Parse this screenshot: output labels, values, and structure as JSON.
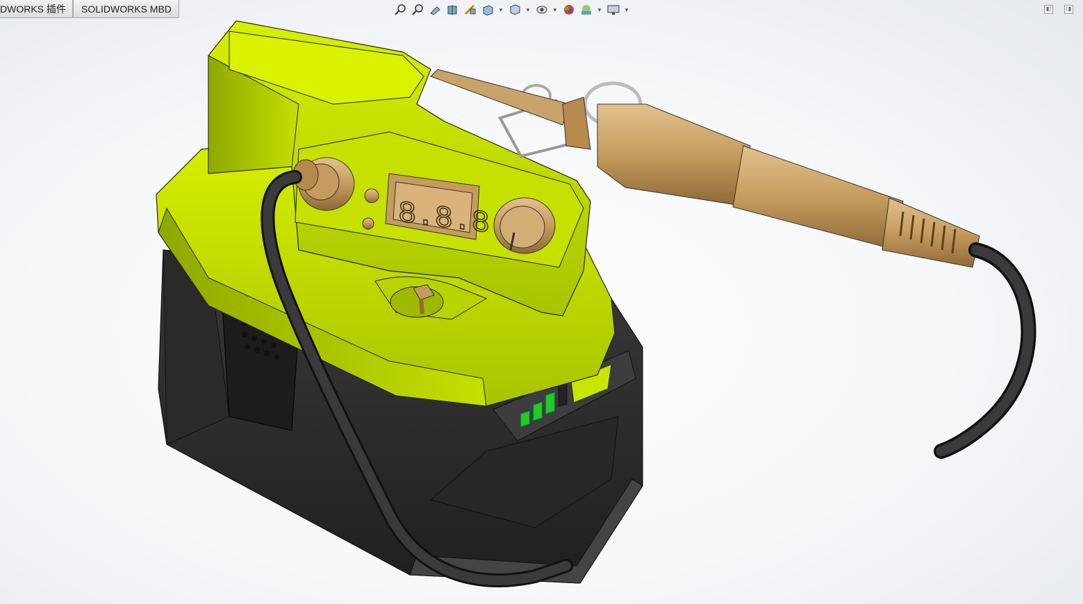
{
  "command_manager": {
    "tabs": [
      {
        "label": "DWORKS 插件"
      },
      {
        "label": "SOLIDWORKS MBD"
      }
    ]
  },
  "heads_up_toolbar": {
    "icons": [
      "zoom-to-fit-icon",
      "zoom-to-area-icon",
      "previous-view-icon",
      "section-view-icon",
      "dynamic-annotation-icon",
      "view-orientation-icon",
      "display-style-icon",
      "hide-show-items-icon",
      "edit-appearance-icon",
      "apply-scene-icon",
      "view-settings-icon"
    ]
  },
  "model": {
    "description_colors": {
      "housing": "#c8e600",
      "battery": "#2e2e2e",
      "iron_handle": "#c9a46a",
      "cable": "#2a2a2a",
      "led_on": "#22cc22"
    },
    "display_digits": "8.8.8",
    "battery_led_levels": 3
  }
}
